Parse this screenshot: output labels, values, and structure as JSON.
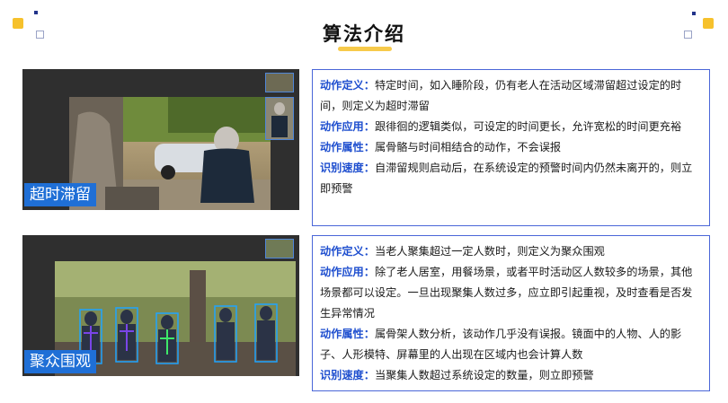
{
  "title": "算法介绍",
  "section1": {
    "tag": "超时滞留",
    "items": [
      {
        "label": "动作定义：",
        "text": "特定时间，如入睡阶段，仍有老人在活动区域滞留超过设定的时间，则定义为超时滞留"
      },
      {
        "label": "动作应用：",
        "text": "跟徘徊的逻辑类似，可设定的时间更长，允许宽松的时间更充裕"
      },
      {
        "label": "动作属性：",
        "text": "属骨骼与时间相结合的动作，不会误报"
      },
      {
        "label": "识别速度：",
        "text": "自滞留规则启动后，在系统设定的预警时间内仍然未离开的，则立即预警"
      }
    ]
  },
  "section2": {
    "tag": "聚众围观",
    "items": [
      {
        "label": "动作定义：",
        "text": "当老人聚集超过一定人数时，则定义为聚众围观"
      },
      {
        "label": "动作应用：",
        "text": "除了老人居室，用餐场景，或者平时活动区人数较多的场景，其他场景都可以设定。一旦出现聚集人数过多，应立即引起重视，及时查看是否发生异常情况"
      },
      {
        "label": "动作属性：",
        "text": "属骨架人数分析，该动作几乎没有误报。镜面中的人物、人的影子、人形模特、屏幕里的人出现在区域内也会计算人数"
      },
      {
        "label": "识别速度：",
        "text": "当聚集人数超过系统设定的数量，则立即预警"
      }
    ]
  },
  "colors": {
    "accent": "#1f4fcf",
    "tag_bg": "#1f6fd6",
    "yellow": "#f6c12c",
    "navy": "#22338a"
  }
}
